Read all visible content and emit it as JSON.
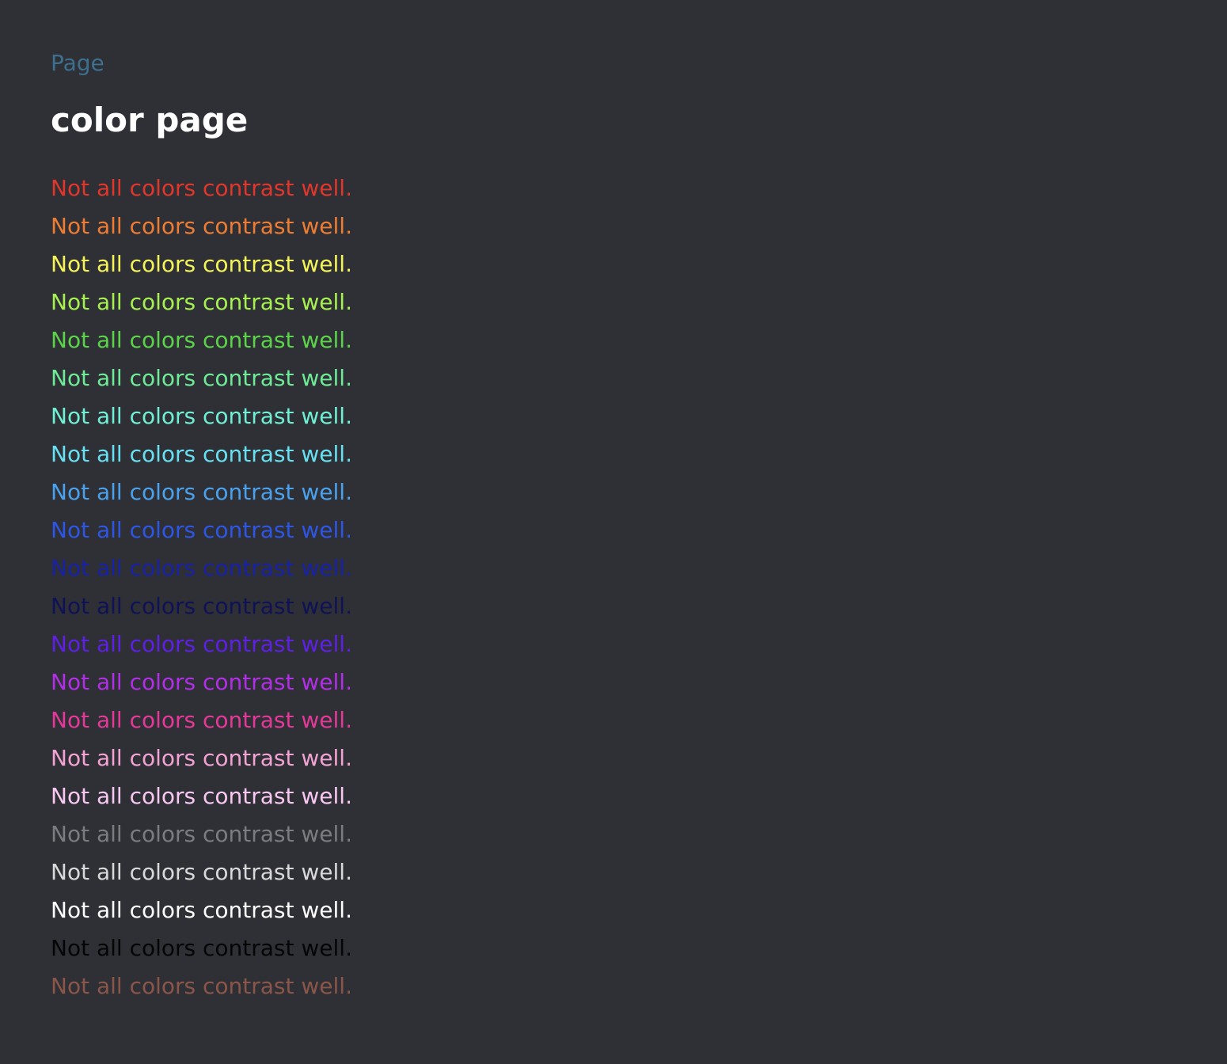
{
  "breadcrumb": "Page",
  "title": "color page",
  "lines": [
    {
      "text": "Not all colors contrast well.",
      "color": "#e0362b"
    },
    {
      "text": "Not all colors contrast well.",
      "color": "#ee7d33"
    },
    {
      "text": "Not all colors contrast well.",
      "color": "#f4f458"
    },
    {
      "text": "Not all colors contrast well.",
      "color": "#a6f14f"
    },
    {
      "text": "Not all colors contrast well.",
      "color": "#5bd44a"
    },
    {
      "text": "Not all colors contrast well.",
      "color": "#6deb97"
    },
    {
      "text": "Not all colors contrast well.",
      "color": "#6ff0d5"
    },
    {
      "text": "Not all colors contrast well.",
      "color": "#67e0f2"
    },
    {
      "text": "Not all colors contrast well.",
      "color": "#4aa2ee"
    },
    {
      "text": "Not all colors contrast well.",
      "color": "#2e56e6"
    },
    {
      "text": "Not all colors contrast well.",
      "color": "#1822a6"
    },
    {
      "text": "Not all colors contrast well.",
      "color": "#0f1257"
    },
    {
      "text": "Not all colors contrast well.",
      "color": "#5e1fe6"
    },
    {
      "text": "Not all colors contrast well.",
      "color": "#b22ee8"
    },
    {
      "text": "Not all colors contrast well.",
      "color": "#e53899"
    },
    {
      "text": "Not all colors contrast well.",
      "color": "#f3a3d3"
    },
    {
      "text": "Not all colors contrast well.",
      "color": "#f8c8f2"
    },
    {
      "text": "Not all colors contrast well.",
      "color": "#7a7d7f"
    },
    {
      "text": "Not all colors contrast well.",
      "color": "#d9d9d9"
    },
    {
      "text": "Not all colors contrast well.",
      "color": "#ffffff"
    },
    {
      "text": "Not all colors contrast well.",
      "color": "#050505"
    },
    {
      "text": "Not all colors contrast well.",
      "color": "#8a5649"
    }
  ]
}
